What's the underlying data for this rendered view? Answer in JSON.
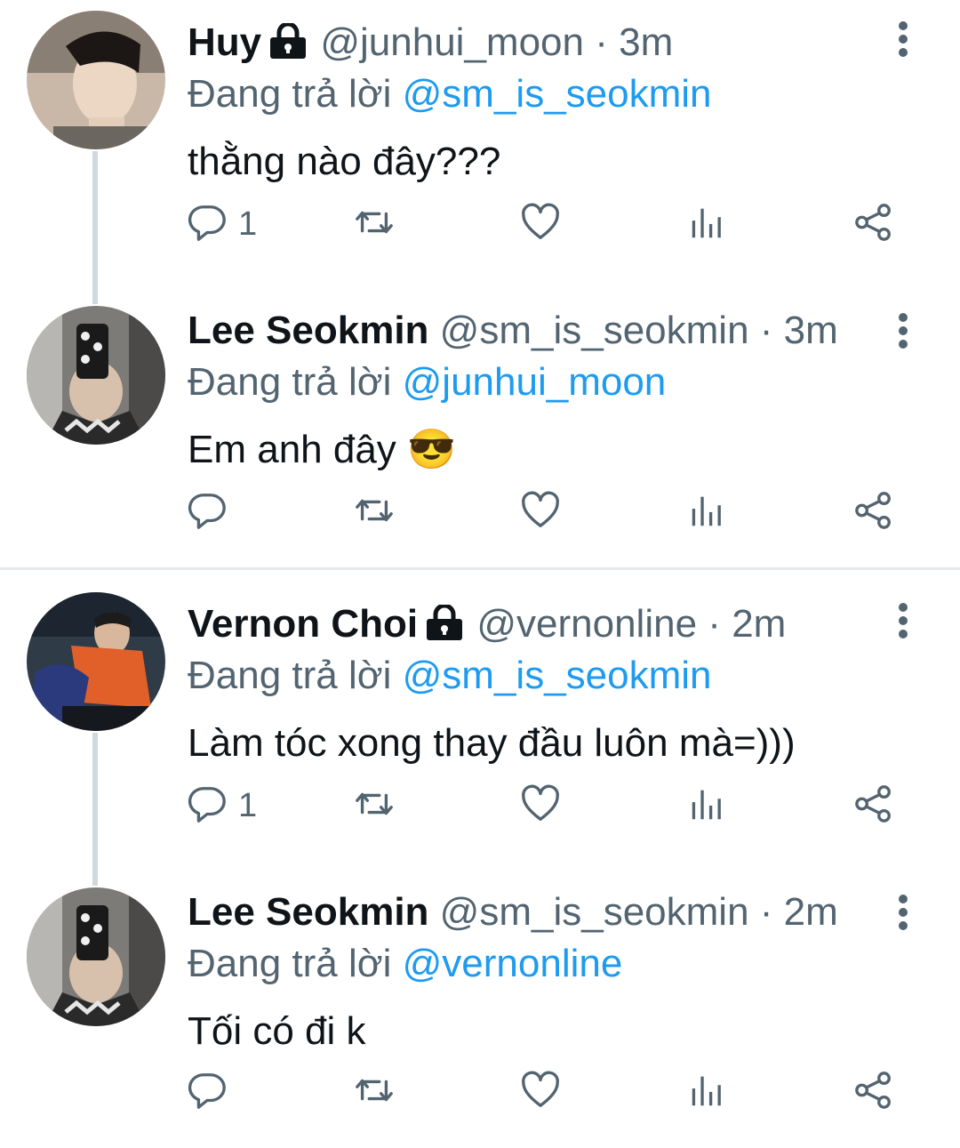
{
  "tweets": [
    {
      "name": "Huy",
      "locked": true,
      "handle": "@junhui_moon",
      "time": "3m",
      "reply_prefix": "Đang trả lời",
      "reply_to": "@sm_is_seokmin",
      "text": "thằng nào đây???",
      "reply_count": "1",
      "avatar": "junhui-avatar"
    },
    {
      "name": "Lee Seokmin",
      "locked": false,
      "handle": "@sm_is_seokmin",
      "time": "3m",
      "reply_prefix": "Đang trả lời",
      "reply_to": "@junhui_moon",
      "text": "Em anh đây 😎",
      "reply_count": "",
      "avatar": "seokmin-avatar"
    },
    {
      "name": "Vernon Choi",
      "locked": true,
      "handle": "@vernonline",
      "time": "2m",
      "reply_prefix": "Đang trả lời",
      "reply_to": "@sm_is_seokmin",
      "text": "Làm tóc xong thay đầu luôn mà=)))",
      "reply_count": "1",
      "avatar": "vernon-avatar"
    },
    {
      "name": "Lee Seokmin",
      "locked": false,
      "handle": "@sm_is_seokmin",
      "time": "2m",
      "reply_prefix": "Đang trả lời",
      "reply_to": "@vernonline",
      "text": "Tối có đi k",
      "reply_count": "",
      "avatar": "seokmin-avatar"
    }
  ],
  "separator": "·",
  "colors": {
    "text": "#0f1419",
    "muted": "#536471",
    "mention": "#1d9bf0",
    "thread_line": "#cfd9de"
  },
  "icons": [
    "reply-icon",
    "retweet-icon",
    "like-icon",
    "views-icon",
    "share-icon",
    "more-icon",
    "lock-icon"
  ]
}
